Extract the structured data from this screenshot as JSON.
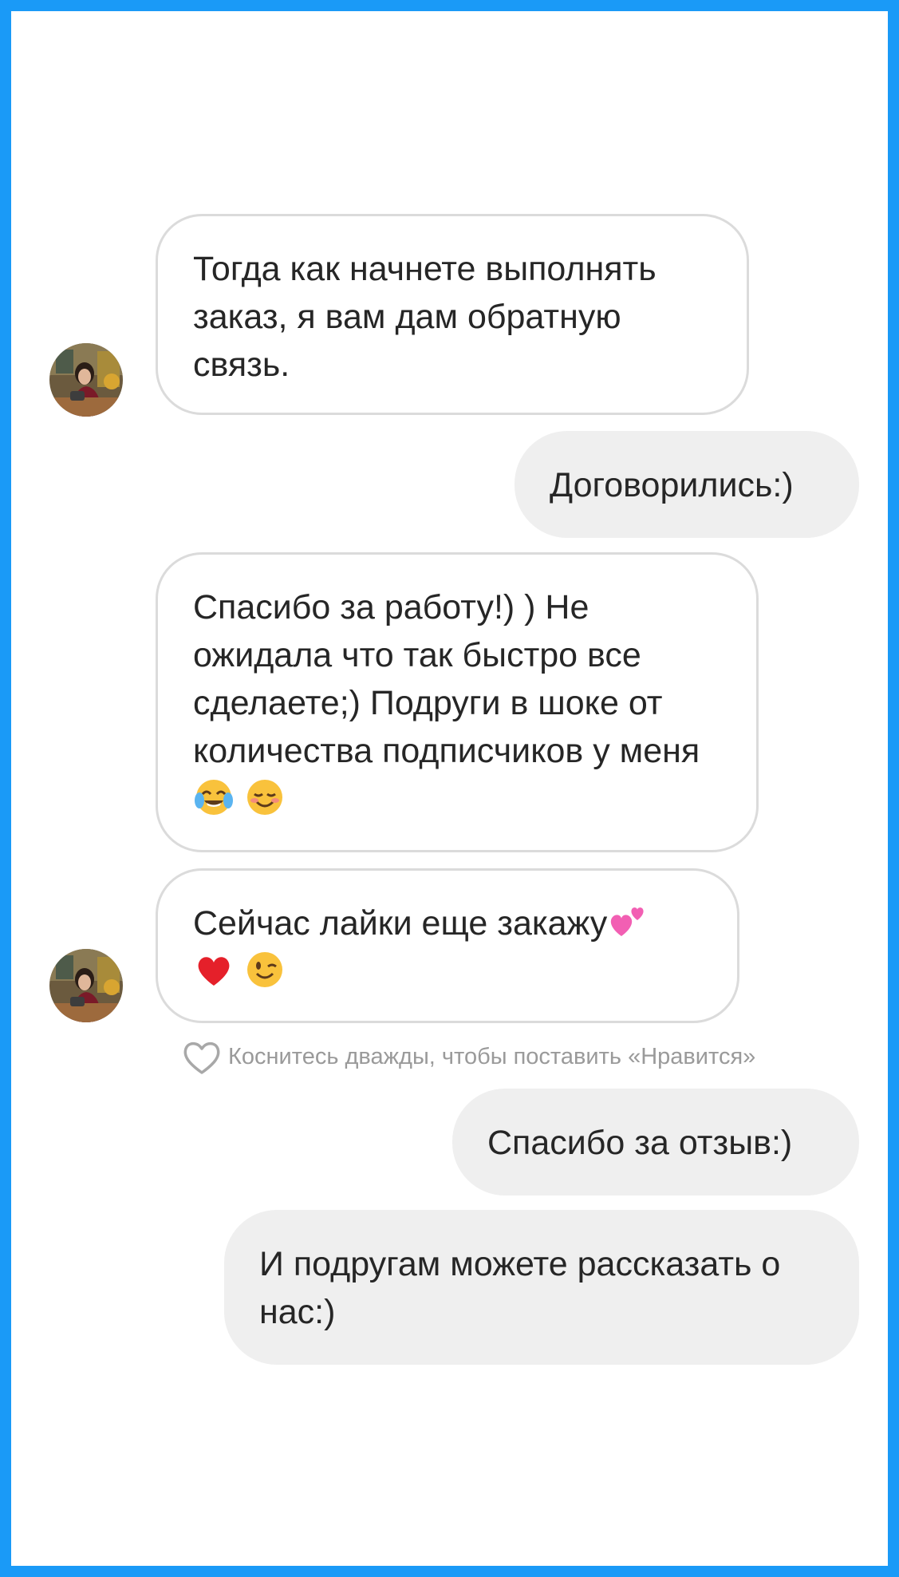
{
  "messages": [
    {
      "id": "m1",
      "direction": "incoming",
      "text": "Тогда как начнете выполнять заказ, я вам дам обратную связь."
    },
    {
      "id": "m2",
      "direction": "outgoing",
      "text": "Договорились:)"
    },
    {
      "id": "m3",
      "direction": "incoming",
      "text": "Спасибо за работу!) ) Не ожидала что так быстро все сделаете;) Подруги в шоке от количества подписчиков у меня",
      "emojis": [
        "face-with-tears-of-joy",
        "smiling-face"
      ]
    },
    {
      "id": "m4",
      "direction": "incoming",
      "text": "Сейчас лайки еще закажу",
      "emojis": [
        "two-hearts",
        "red-heart",
        "winking-face"
      ]
    },
    {
      "id": "m5",
      "direction": "outgoing",
      "text": "Спасибо за отзыв:)"
    },
    {
      "id": "m6",
      "direction": "outgoing",
      "text": "И подругам можете рассказать о нас:)"
    }
  ],
  "like_hint": "Коснитесь дважды, чтобы поставить «Нравится»",
  "colors": {
    "frame": "#1a9af7",
    "incoming_bubble_border": "#dbdbdb",
    "outgoing_bubble_bg": "#efefef",
    "text": "#262626",
    "hint_text": "#9a9a9a"
  }
}
